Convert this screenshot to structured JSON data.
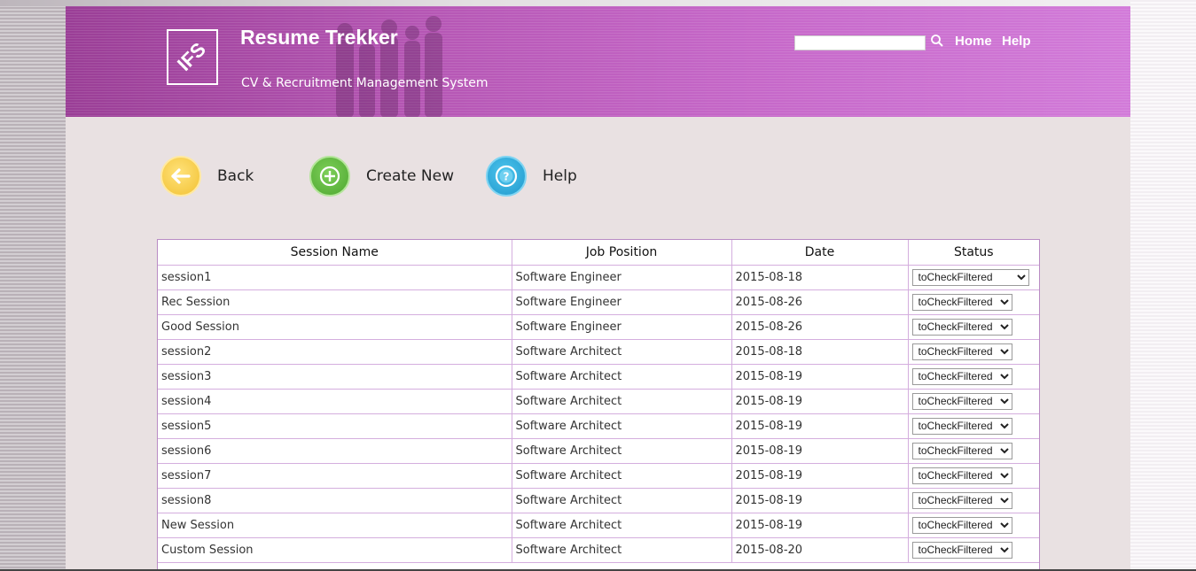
{
  "header": {
    "title": "Resume Trekker",
    "subtitle": "CV & Recruitment Management System",
    "logo_text": "IFS",
    "search": {
      "value": "",
      "placeholder": ""
    },
    "nav": {
      "home": "Home",
      "help": "Help"
    }
  },
  "actions": {
    "back": "Back",
    "create_new": "Create New",
    "help": "Help"
  },
  "table": {
    "columns": [
      "Session Name",
      "Job Position",
      "Date",
      "Status"
    ],
    "rows": [
      {
        "session": "session1",
        "position": "Software Engineer",
        "date": "2015-08-18",
        "status": "toCheckFiltered"
      },
      {
        "session": "Rec Session",
        "position": "Software Engineer",
        "date": "2015-08-26",
        "status": "toCheckFiltered"
      },
      {
        "session": "Good Session",
        "position": "Software Engineer",
        "date": "2015-08-26",
        "status": "toCheckFiltered"
      },
      {
        "session": "session2",
        "position": "Software Architect",
        "date": "2015-08-18",
        "status": "toCheckFiltered"
      },
      {
        "session": "session3",
        "position": "Software Architect",
        "date": "2015-08-19",
        "status": "toCheckFiltered"
      },
      {
        "session": "session4",
        "position": "Software Architect",
        "date": "2015-08-19",
        "status": "toCheckFiltered"
      },
      {
        "session": "session5",
        "position": "Software Architect",
        "date": "2015-08-19",
        "status": "toCheckFiltered"
      },
      {
        "session": "session6",
        "position": "Software Architect",
        "date": "2015-08-19",
        "status": "toCheckFiltered"
      },
      {
        "session": "session7",
        "position": "Software Architect",
        "date": "2015-08-19",
        "status": "toCheckFiltered"
      },
      {
        "session": "session8",
        "position": "Software Architect",
        "date": "2015-08-19",
        "status": "toCheckFiltered"
      },
      {
        "session": "New Session",
        "position": "Software Architect",
        "date": "2015-08-19",
        "status": "toCheckFiltered"
      },
      {
        "session": "Custom Session",
        "position": "Software Architect",
        "date": "2015-08-20",
        "status": "toCheckFiltered"
      }
    ]
  },
  "icons": {
    "back": "arrow-left-icon",
    "create_new": "plus-circle-icon",
    "help": "question-circle-icon",
    "search": "search-icon"
  },
  "colors": {
    "header_start": "#9a3e96",
    "header_end": "#d27bd9",
    "content_bg": "#e9e1e2",
    "table_border": "#d4aede"
  }
}
